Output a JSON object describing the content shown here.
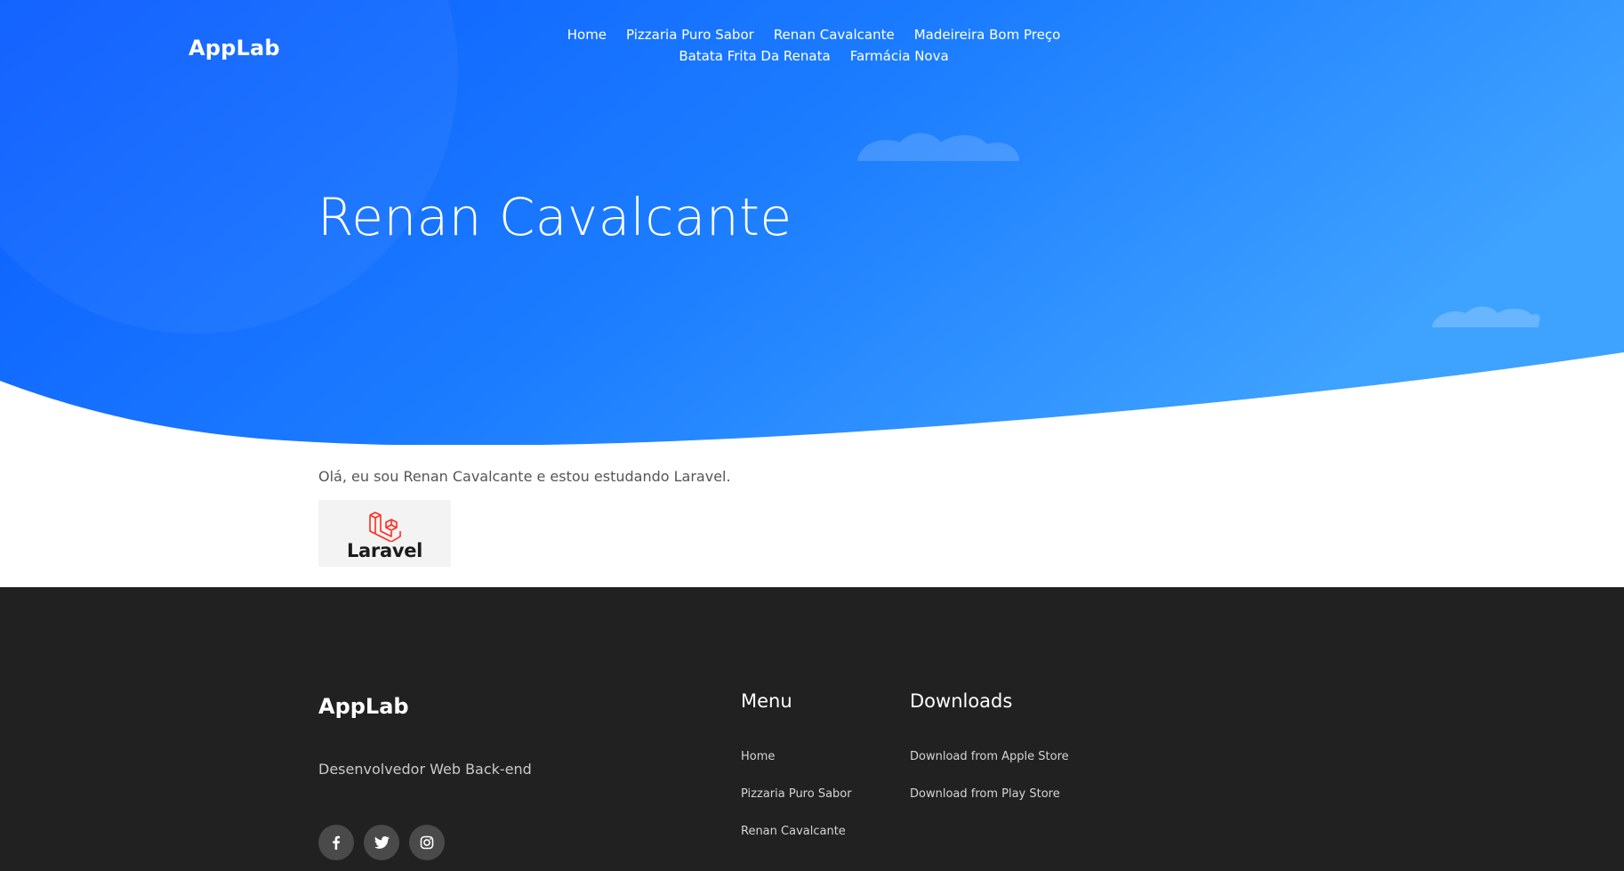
{
  "header": {
    "logo": "AppLab",
    "nav": [
      "Home",
      "Pizzaria Puro Sabor",
      "Renan Cavalcante",
      "Madeireira Bom Preço",
      "Batata Frita Da Renata",
      "Farmácia Nova"
    ]
  },
  "hero": {
    "title": "Renan Cavalcante"
  },
  "main": {
    "intro": "Olá, eu sou Renan Cavalcante e estou estudando Laravel.",
    "image_text": "Laravel"
  },
  "footer": {
    "logo": "AppLab",
    "tagline": "Desenvolvedor Web Back-end",
    "socials": [
      "facebook-icon",
      "twitter-icon",
      "instagram-icon"
    ],
    "menu": {
      "title": "Menu",
      "items": [
        "Home",
        "Pizzaria Puro Sabor",
        "Renan Cavalcante"
      ]
    },
    "downloads": {
      "title": "Downloads",
      "items": [
        "Download from Apple Store",
        "Download from Play Store"
      ]
    }
  },
  "colors": {
    "hero_gradient_start": "#0a5cff",
    "hero_gradient_end": "#3ea2ff",
    "footer_bg": "#212121",
    "laravel_red": "#ff2d20"
  }
}
